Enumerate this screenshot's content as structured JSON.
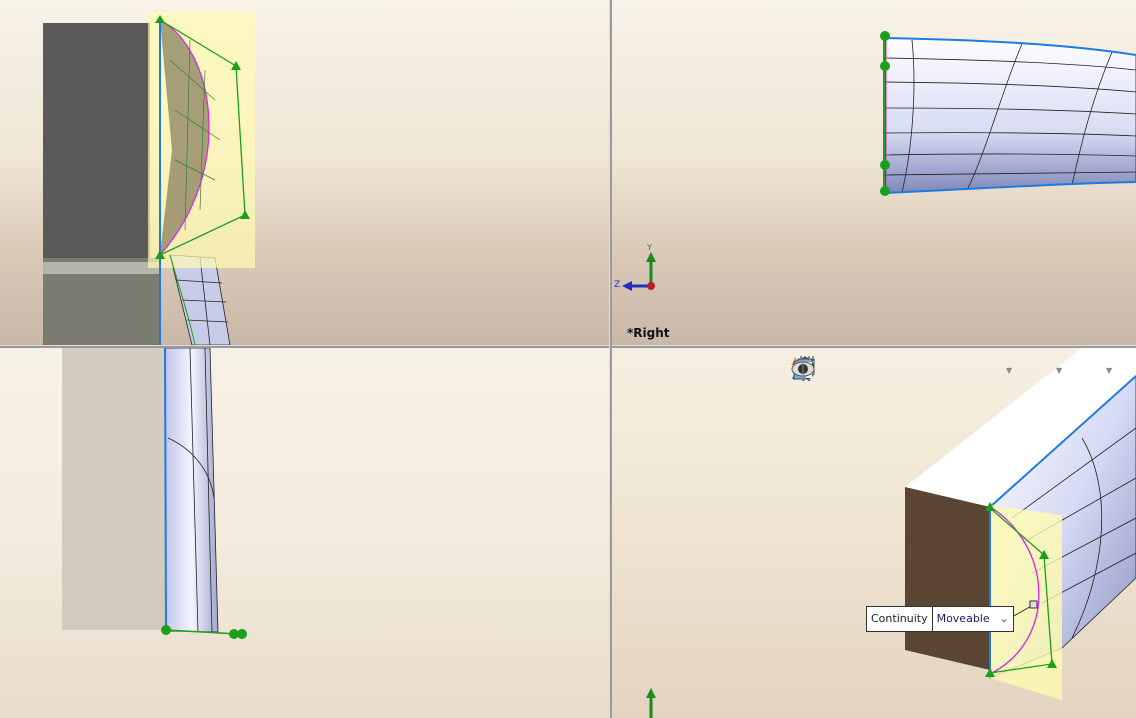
{
  "viewports": {
    "top_right": {
      "label": "*Right",
      "triad": {
        "y_axis": "Y",
        "z_axis": "Z"
      }
    },
    "bottom_right": {
      "toolbar": [
        {
          "icon": "zoom-to-fit-icon"
        },
        {
          "icon": "zoom-to-area-icon"
        },
        {
          "icon": "previous-view-icon"
        },
        {
          "icon": "section-view-icon"
        },
        {
          "icon": "dynamic-annotation-views-icon"
        },
        {
          "icon": "view-orientation-icon",
          "dropdown": true
        },
        {
          "icon": "display-style-icon",
          "dropdown": true
        },
        {
          "icon": "hide-show-items-icon",
          "dropdown": true
        }
      ],
      "tooltip": {
        "label": "Continuity",
        "value": "Moveable"
      }
    }
  },
  "colors": {
    "edge_blue": "#1e7be0",
    "handle_green": "#1aa01a",
    "curvature_magenta": "#e020e0",
    "selection_yellow": "#fffbb0"
  }
}
